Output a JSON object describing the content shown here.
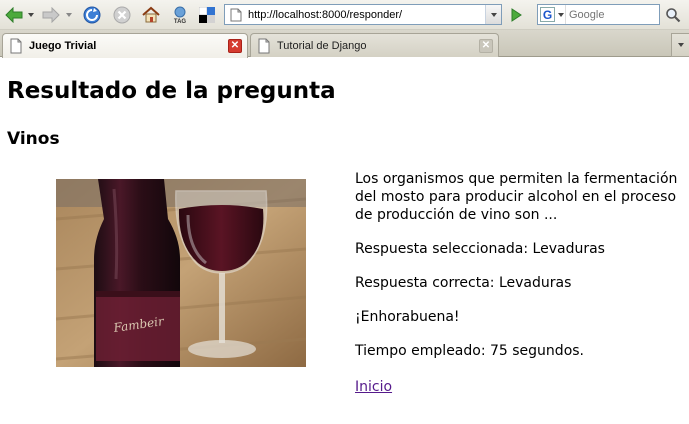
{
  "browser": {
    "url": "http://localhost:8000/responder/",
    "search_placeholder": "Google",
    "tabs": [
      {
        "label": "Juego Trivial",
        "active": true
      },
      {
        "label": "Tutorial de Django",
        "active": false
      }
    ]
  },
  "page": {
    "title": "Resultado de la pregunta",
    "category": "Vinos",
    "question": "Los organismos que permiten la fermentación del mosto para producir alcohol en el proceso de producción de vino son ...",
    "selected_answer": "Respuesta seleccionada: Levaduras",
    "correct_answer": "Respuesta correcta: Levaduras",
    "result_message": "¡Enhorabuena!",
    "time_used": "Tiempo empleado: 75 segundos.",
    "home_link": "Inicio"
  },
  "colors": {
    "link_visited": "#551a8b",
    "close_tab_active": "#d53b2f"
  }
}
